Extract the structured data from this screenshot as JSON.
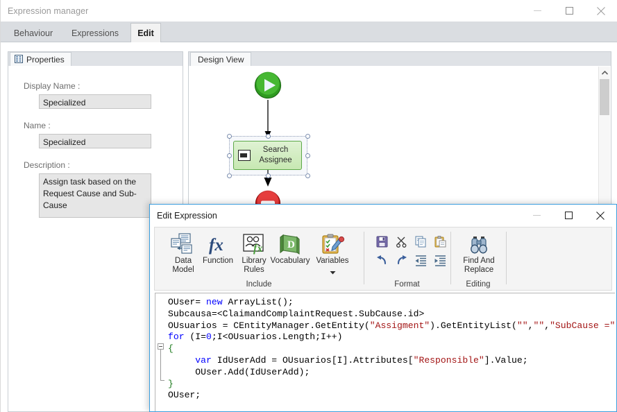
{
  "main_window": {
    "title": "Expression manager",
    "window_controls": [
      {
        "name": "minimize",
        "glyph": "minimize-icon"
      },
      {
        "name": "maximize",
        "glyph": "maximize-icon"
      },
      {
        "name": "close",
        "glyph": "close-icon"
      }
    ],
    "tabs": [
      {
        "label": "Behaviour",
        "active": false
      },
      {
        "label": "Expressions",
        "active": false
      },
      {
        "label": "Edit",
        "active": true
      }
    ]
  },
  "properties_panel": {
    "tab_label": "Properties",
    "fields": [
      {
        "label": "Display Name :",
        "value": "Specialized"
      },
      {
        "label": "Name :",
        "value": "Specialized"
      },
      {
        "label": "Description :",
        "value": "Assign task based on the Request Cause and Sub-Cause"
      }
    ]
  },
  "design_view": {
    "tab_label": "Design View",
    "nodes": [
      {
        "type": "start",
        "name": "start-node"
      },
      {
        "type": "task",
        "name": "search-assignee-node",
        "label_line1": "Search",
        "label_line2": "Assignee",
        "selected": true
      },
      {
        "type": "stop",
        "name": "stop-node"
      }
    ],
    "scrollbar": {
      "name": "design-vertical-scrollbar"
    }
  },
  "dialog": {
    "title": "Edit Expression",
    "window_controls": [
      {
        "name": "minimize",
        "glyph": "minimize-icon"
      },
      {
        "name": "maximize",
        "glyph": "maximize-icon"
      },
      {
        "name": "close",
        "glyph": "close-icon"
      }
    ],
    "ribbon": {
      "groups": [
        {
          "caption": "Include",
          "buttons": [
            {
              "label_line1": "Data",
              "label_line2": "Model",
              "icon": "data-model-icon"
            },
            {
              "label_line1": "Function",
              "label_line2": "",
              "icon": "function-fx-icon"
            },
            {
              "label_line1": "Library",
              "label_line2": "Rules",
              "icon": "library-rules-icon"
            },
            {
              "label_line1": "Vocabulary",
              "label_line2": "",
              "icon": "vocabulary-book-icon"
            },
            {
              "label_line1": "Variables",
              "label_line2": "",
              "icon": "variables-clipboard-icon",
              "has_dropdown": true
            }
          ]
        },
        {
          "caption": "Format",
          "buttons": [
            {
              "icon": "save-icon"
            },
            {
              "icon": "cut-scissors-icon"
            },
            {
              "icon": "copy-icon"
            },
            {
              "icon": "paste-icon"
            },
            {
              "icon": "undo-icon"
            },
            {
              "icon": "redo-icon"
            },
            {
              "icon": "decrease-indent-icon"
            },
            {
              "icon": "increase-indent-icon"
            }
          ]
        },
        {
          "caption": "Editing",
          "buttons": [
            {
              "label_line1": "Find And",
              "label_line2": "Replace",
              "icon": "find-replace-binoculars-icon"
            }
          ]
        }
      ]
    },
    "editor": {
      "lines": [
        "OUser= new ArrayList();",
        "Subcausa=<ClaimandComplaintRequest.SubCause.id>",
        "OUsuarios = CEntityManager.GetEntity(\"Assigment\").GetEntityList(\"\",\"\",\"SubCause =\"",
        "for (I=0;I<OUsuarios.Length;I++)",
        "{",
        "     var IdUserAdd = OUsuarios[I].Attributes[\"Responsible\"].Value;",
        "     OUser.Add(IdUserAdd);",
        "}",
        "OUser;"
      ]
    }
  },
  "colors": {
    "accent_blue": "#3a9ede",
    "tabstrip": "#dadde1",
    "node_green_border": "#5da848",
    "node_green_fill": "#c7e8b2",
    "keyword_blue": "#0000ff",
    "string_red": "#a31515",
    "brace_green": "#1b7a1b"
  }
}
